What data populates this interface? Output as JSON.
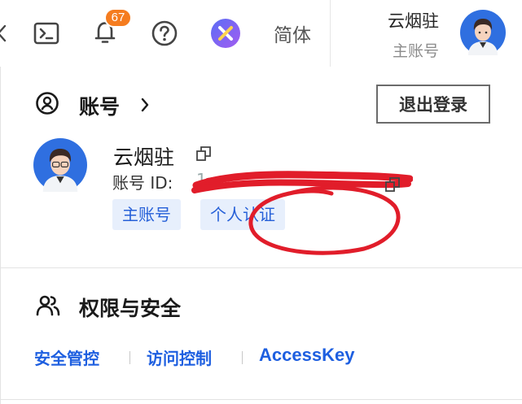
{
  "topbar": {
    "notification_count": "67",
    "language": "简体",
    "username": "云烟驻",
    "account_type": "主账号",
    "icons": [
      "chevron-left-icon",
      "terminal-icon",
      "bell-icon",
      "help-icon",
      "app-logo-icon",
      "avatar"
    ]
  },
  "account": {
    "title": "账号",
    "logout_label": "退出登录",
    "name": "云烟驻",
    "id_label": "账号 ID:",
    "id_value": "1",
    "tags": [
      "主账号",
      "个人认证"
    ]
  },
  "security": {
    "title": "权限与安全",
    "links": [
      "安全管控",
      "访问控制",
      "AccessKey"
    ]
  },
  "colors": {
    "badge": "#f57c1f",
    "link": "#1e5fe0",
    "tag_bg": "#e7effc",
    "annotation_red": "#e11d2a"
  }
}
